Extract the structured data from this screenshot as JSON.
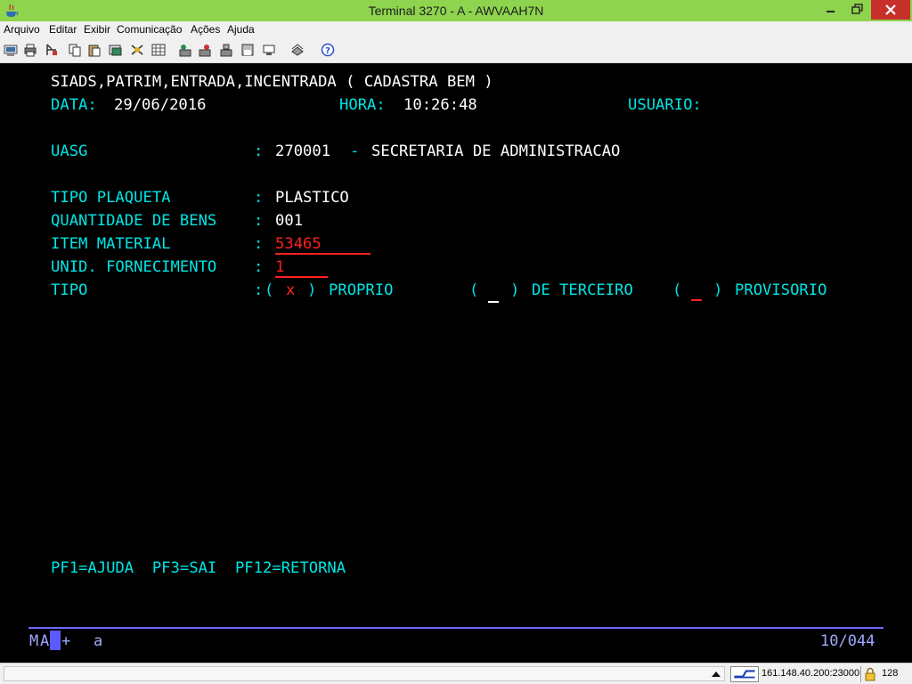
{
  "window": {
    "title": "Terminal 3270 - A - AWVAAH7N"
  },
  "menu": [
    "Arquivo",
    "Editar",
    "Exibir",
    "Comunicação",
    "Ações",
    "Ajuda"
  ],
  "toolbar_icons": [
    "print-screen-icon",
    "print-icon",
    "send-file-icon",
    "copy-icon",
    "paste-icon",
    "clipboard-icon",
    "macro-icon",
    "keypad-icon",
    "record-macro-icon",
    "stop-macro-icon",
    "play-macro-icon",
    "disk-icon",
    "display-icon",
    "options-icon",
    "help-icon"
  ],
  "screen": {
    "header": "SIADS,PATRIM,ENTRADA,INCENTRADA ( CADASTRA BEM )",
    "date_label": "DATA:",
    "date_value": "29/06/2016",
    "time_label": "HORA:",
    "time_value": "10:26:48",
    "user_label": "USUARIO:",
    "uasg_label": "UASG",
    "uasg_colon": ":",
    "uasg_code": "270001",
    "uasg_dash": "-",
    "uasg_name": "SECRETARIA DE ADMINISTRACAO",
    "tipo_plaqueta_label": "TIPO PLAQUETA",
    "tipo_plaqueta_colon": ":",
    "tipo_plaqueta_value": "PLASTICO",
    "quantidade_label": "QUANTIDADE DE BENS",
    "quantidade_colon": ":",
    "quantidade_value": "001",
    "item_material_label": "ITEM MATERIAL",
    "item_material_colon": ":",
    "item_material_value": "53465",
    "unid_label": "UNID. FORNECIMENTO",
    "unid_colon": ":",
    "unid_value": "1",
    "tipo_label": "TIPO",
    "tipo_colon": ":",
    "opt_open": "(",
    "opt_close": ")",
    "opt_proprio_mark": "x",
    "opt_proprio_label": "PROPRIO",
    "opt_terceiro_label": "DE TERCEIRO",
    "opt_provisorio_label": "PROVISORIO",
    "pf_keys": "PF1=AJUDA  PF3=SAI  PF12=RETORNA"
  },
  "oia": {
    "mode_left": "M",
    "mode_a": "A",
    "plus": "+",
    "small_a": "a",
    "cursor_pos": "10/044"
  },
  "status": {
    "host": "161.148.40.200:23000",
    "bits": "128"
  },
  "colors": {
    "titlebar": "#8ed44e",
    "close": "#c7302a",
    "field_white": "#ffffff",
    "field_cyan": "#00e5e5",
    "field_red": "#ff2020",
    "oia": "#9fa8ff"
  }
}
